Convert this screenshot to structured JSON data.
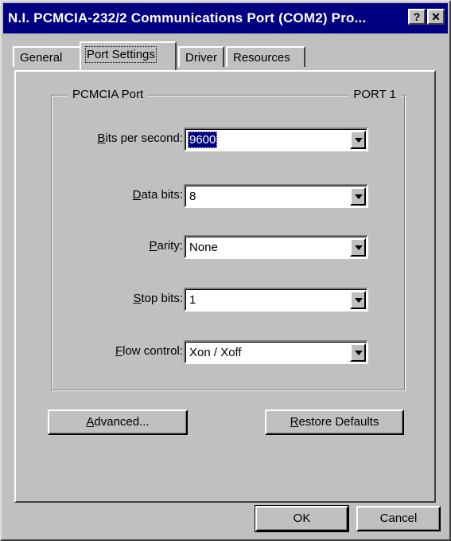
{
  "window": {
    "title": "N.I. PCMCIA-232/2 Communications Port (COM2) Pro...",
    "help_button": "?",
    "close_button": "✕"
  },
  "tabs": [
    {
      "label": "General",
      "active": false
    },
    {
      "label": "Port Settings",
      "active": true
    },
    {
      "label": "Driver",
      "active": false
    },
    {
      "label": "Resources",
      "active": false
    }
  ],
  "group": {
    "left_label": "PCMCIA Port",
    "right_label": "PORT 1"
  },
  "fields": {
    "bits_per_second": {
      "label_key": "B",
      "label_rest": "its per second:",
      "value": "9600"
    },
    "data_bits": {
      "label_key": "D",
      "label_rest": "ata bits:",
      "value": "8"
    },
    "parity": {
      "label_pre": "",
      "label_key": "P",
      "label_rest": "arity:",
      "value": "None"
    },
    "stop_bits": {
      "label_key": "S",
      "label_rest": "top bits:",
      "value": "1"
    },
    "flow_control": {
      "label_key": "F",
      "label_rest": "low control:",
      "value": "Xon / Xoff"
    }
  },
  "buttons": {
    "advanced_key": "A",
    "advanced_rest": "dvanced...",
    "restore_key": "R",
    "restore_rest": "estore Defaults",
    "ok": "OK",
    "cancel": "Cancel"
  },
  "colors": {
    "titlebar": "#000080",
    "face": "#c0c0c0",
    "selection": "#000080"
  }
}
